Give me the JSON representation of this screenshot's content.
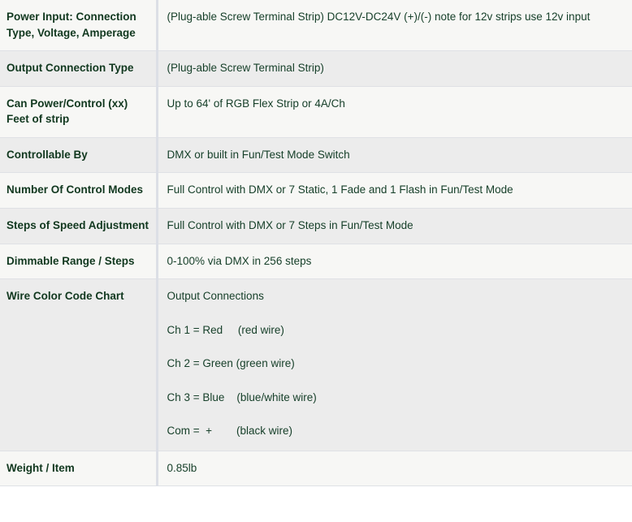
{
  "table": {
    "rows": [
      {
        "label": "Power Input: Connection Type, Voltage, Amperage",
        "value": "(Plug-able Screw Terminal Strip) DC12V-DC24V (+)/(-) note for 12v strips use 12v input"
      },
      {
        "label": "Output Connection Type",
        "value": "(Plug-able Screw Terminal Strip)"
      },
      {
        "label": "Can Power/Control (xx) Feet of strip",
        "value": "Up to 64' of RGB Flex Strip or 4A/Ch"
      },
      {
        "label": "Controllable By",
        "value": "DMX or built in Fun/Test Mode Switch"
      },
      {
        "label": "Number Of Control Modes",
        "value": "Full Control with DMX or 7 Static, 1 Fade and 1 Flash in Fun/Test Mode"
      },
      {
        "label": "Steps of Speed Adjustment",
        "value": "Full Control with DMX or 7 Steps in Fun/Test Mode"
      },
      {
        "label": "Dimmable Range / Steps",
        "value": "0-100% via DMX in 256 steps"
      },
      {
        "label": "Wire Color Code Chart",
        "wire_chart": {
          "heading": "Output Connections",
          "lines": [
            "Ch 1 = Red     (red wire)",
            "Ch 2 = Green (green wire)",
            "Ch 3 = Blue    (blue/white wire)",
            "Com =  +        (black wire)"
          ]
        }
      },
      {
        "label": "Weight / Item",
        "value": "0.85lb"
      }
    ]
  },
  "colors": {
    "label_text": "#11381f",
    "value_text": "#17402a",
    "row_odd_bg": "#f7f7f5",
    "row_even_bg": "#ececec",
    "divider": "#dcdfe6",
    "row_border": "#dfe1e5"
  }
}
